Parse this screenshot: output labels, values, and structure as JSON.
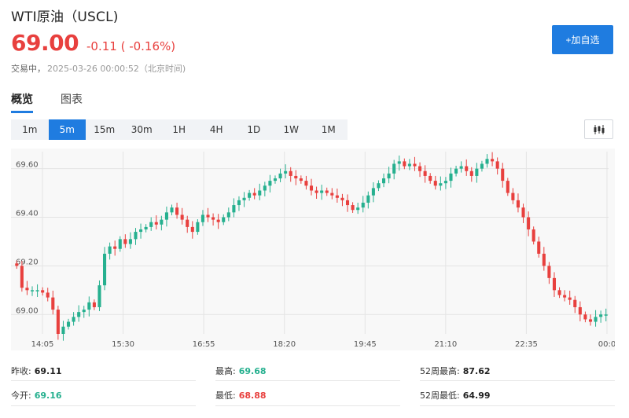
{
  "header": {
    "title": "WTI原油（USCL)",
    "price": "69.00",
    "change": "-0.11 ( -0.16%)",
    "status": "交易中，",
    "timestamp": "2025-03-26 00:00:52（北京时间)",
    "watch_button": "+加自选"
  },
  "tabs": [
    {
      "label": "概览",
      "active": true
    },
    {
      "label": "图表",
      "active": false
    }
  ],
  "ranges": [
    {
      "label": "1m",
      "active": false
    },
    {
      "label": "5m",
      "active": true
    },
    {
      "label": "15m",
      "active": false
    },
    {
      "label": "30m",
      "active": false
    },
    {
      "label": "1H",
      "active": false
    },
    {
      "label": "4H",
      "active": false
    },
    {
      "label": "1D",
      "active": false
    },
    {
      "label": "1W",
      "active": false
    },
    {
      "label": "1M",
      "active": false
    }
  ],
  "chart_type_icon": "candlestick-icon",
  "colors": {
    "up": "#26b08f",
    "down": "#e8403e",
    "accent": "#1f7ce0"
  },
  "chart_data": {
    "type": "candlestick",
    "ylim": [
      68.92,
      69.67
    ],
    "y_ticks": [
      "69.60",
      "69.40",
      "69.20",
      "69.00"
    ],
    "x_ticks": [
      "14:05",
      "15:30",
      "16:55",
      "18:20",
      "19:45",
      "21:10",
      "22:35",
      "00:0"
    ],
    "grid": true,
    "series_close": [
      69.2,
      69.11,
      69.1,
      69.1,
      69.1,
      69.09,
      69.07,
      69.02,
      68.92,
      68.95,
      68.97,
      68.99,
      69.01,
      69.02,
      69.05,
      69.03,
      69.12,
      69.25,
      69.28,
      69.27,
      69.31,
      69.29,
      69.31,
      69.34,
      69.35,
      69.36,
      69.38,
      69.37,
      69.39,
      69.42,
      69.44,
      69.41,
      69.39,
      69.36,
      69.34,
      69.38,
      69.41,
      69.4,
      69.39,
      69.38,
      69.4,
      69.42,
      69.45,
      69.47,
      69.48,
      69.5,
      69.49,
      69.51,
      69.53,
      69.55,
      69.56,
      69.58,
      69.59,
      69.57,
      69.56,
      69.55,
      69.53,
      69.51,
      69.5,
      69.51,
      69.5,
      69.49,
      69.48,
      69.47,
      69.45,
      69.43,
      69.44,
      69.46,
      69.49,
      69.52,
      69.54,
      69.56,
      69.58,
      69.62,
      69.63,
      69.61,
      69.62,
      69.61,
      69.59,
      69.57,
      69.55,
      69.53,
      69.54,
      69.55,
      69.58,
      69.6,
      69.61,
      69.59,
      69.57,
      69.6,
      69.62,
      69.64,
      69.63,
      69.6,
      69.55,
      69.5,
      69.47,
      69.44,
      69.4,
      69.35,
      69.3,
      69.25,
      69.2,
      69.15,
      69.1,
      69.08,
      69.07,
      69.06,
      69.03,
      69.0,
      68.98,
      68.97,
      68.99,
      69.0,
      69.0
    ]
  },
  "stats": {
    "prev_close_label": "昨收:",
    "prev_close": "69.11",
    "open_label": "今开:",
    "open": "69.16",
    "high_label": "最高:",
    "high": "69.68",
    "low_label": "最低:",
    "low": "68.88",
    "high52_label": "52周最高:",
    "high52": "87.62",
    "low52_label": "52周最低:",
    "low52": "64.99"
  }
}
